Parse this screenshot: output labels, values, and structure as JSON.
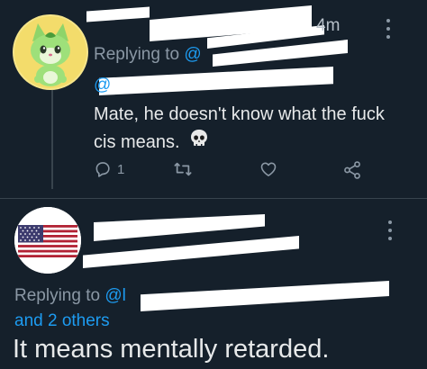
{
  "tweet1": {
    "time": "4m",
    "replying_to_prefix": "Replying to",
    "replying_to_handle_start": "@",
    "text_line1": "Mate, he doesn't know what the fuck",
    "text_line2": "cis means.",
    "emoji": "💀",
    "reply_count": "1",
    "icons": {
      "avatar": "sprigatito-avatar",
      "reply": "reply-icon",
      "retweet": "retweet-icon",
      "like": "like-icon",
      "share": "share-icon",
      "more": "more-vertical-icon"
    }
  },
  "tweet2": {
    "replying_to_prefix": "Replying to",
    "replying_to_handle_start": "@l",
    "and_others": "and 2 others",
    "text": "It means mentally retarded.",
    "icons": {
      "avatar": "us-flag-avatar",
      "more": "more-vertical-icon"
    }
  },
  "colors": {
    "background": "#15202b",
    "text": "#e7e9ea",
    "muted": "#8b98a5",
    "link": "#1d9bf0",
    "redaction": "#ffffff"
  }
}
